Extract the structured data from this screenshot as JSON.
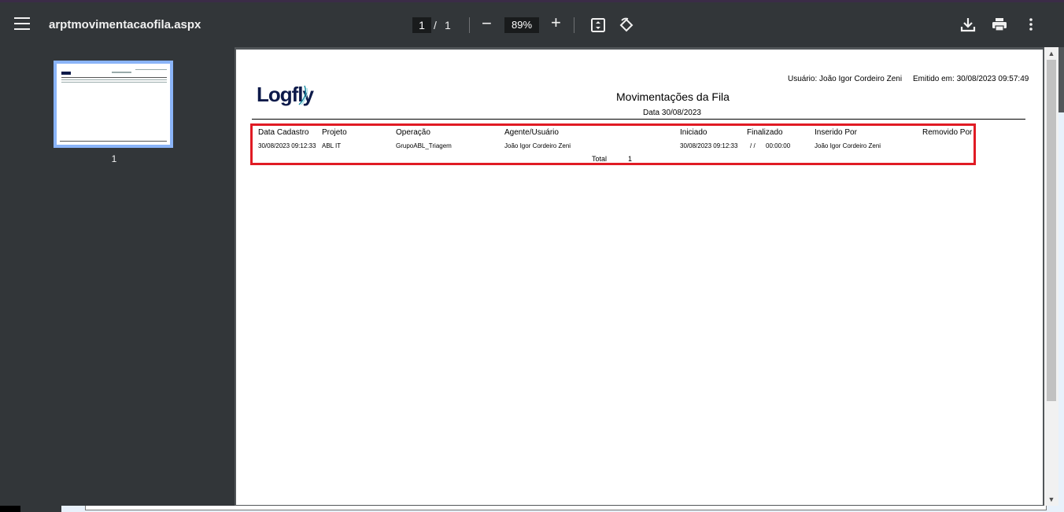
{
  "toolbar": {
    "document_title": "arptmovimentacaofila.aspx",
    "current_page": "1",
    "page_separator": "/",
    "total_pages": "1",
    "zoom": "89%",
    "zoom_out_symbol": "−",
    "zoom_in_symbol": "+"
  },
  "sidebar": {
    "thumbnail_label": "1"
  },
  "report": {
    "logo_text": "Logfly",
    "user": "Usuário: João Igor Cordeiro Zeni",
    "emitted": "Emitido em: 30/08/2023 09:57:49",
    "title": "Movimentações da Fila",
    "date": "Data 30/08/2023",
    "columns": [
      "Data Cadastro",
      "Projeto",
      "Operação",
      "Agente/Usuário",
      "Iniciado",
      "Finalizado",
      "Inserido Por",
      "Removido Por"
    ],
    "rows": [
      [
        "30/08/2023 09:12:33",
        "ABL IT",
        "GrupoABL_Triagem",
        "João Igor Cordeiro Zeni",
        "30/08/2023 09:12:33",
        "/ /",
        "00:00:00",
        "João Igor Cordeiro Zeni"
      ]
    ],
    "total_label": "Total",
    "total_value": "1"
  },
  "colors": {
    "toolbar_bg": "#323639",
    "thumbnail_border": "#8ab4f8",
    "highlight_border": "#e01b24"
  }
}
